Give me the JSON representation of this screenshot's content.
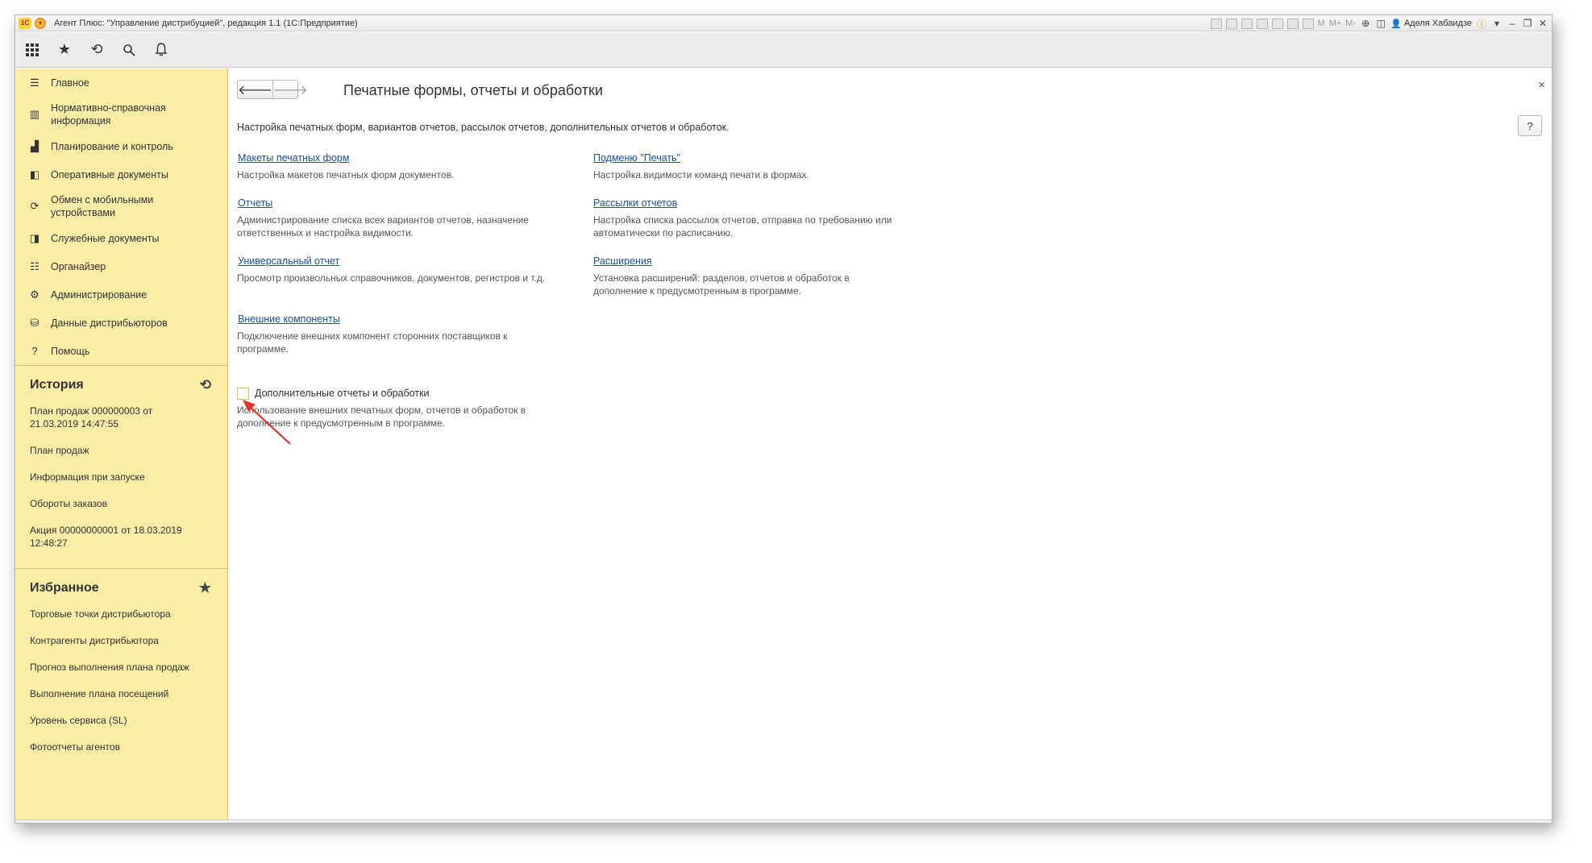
{
  "window": {
    "title": "Агент Плюс: \"Управление дистрибуцией\", редакция 1.1  (1С:Предприятие)",
    "user": "Аделя Хабаидзе",
    "toolbar_text": [
      "M",
      "M+",
      "M-"
    ]
  },
  "sections": [
    {
      "label": "Главное",
      "icon": "menu-icon"
    },
    {
      "label": "Нормативно-справочная информация",
      "icon": "catalog-icon"
    },
    {
      "label": "Планирование и контроль",
      "icon": "chart-icon"
    },
    {
      "label": "Оперативные документы",
      "icon": "documents-icon"
    },
    {
      "label": "Обмен с мобильными устройствами",
      "icon": "sync-icon"
    },
    {
      "label": "Служебные документы",
      "icon": "service-docs-icon"
    },
    {
      "label": "Органайзер",
      "icon": "organizer-icon"
    },
    {
      "label": "Администрирование",
      "icon": "gear-icon"
    },
    {
      "label": "Данные дистрибьюторов",
      "icon": "distributor-data-icon"
    },
    {
      "label": "Помощь",
      "icon": "question-icon"
    }
  ],
  "history": {
    "title": "История",
    "items": [
      "План продаж 000000003 от 21.03.2019 14:47:55",
      "План продаж",
      "Информация при запуске",
      "Обороты заказов",
      "Акция 00000000001 от 18.03.2019 12:48:27"
    ]
  },
  "favorites": {
    "title": "Избранное",
    "items": [
      "Торговые точки дистрибьютора",
      "Контрагенты дистрибьютора",
      "Прогноз выполнения плана продаж",
      "Выполнение плана посещений",
      "Уровень сервиса (SL)",
      "Фотоотчеты агентов"
    ]
  },
  "main": {
    "title": "Печатные формы, отчеты и обработки",
    "description": "Настройка печатных форм, вариантов отчетов, рассылок отчетов, дополнительных отчетов и обработок.",
    "help": "?",
    "close": "×",
    "links": {
      "layouts": {
        "label": "Макеты печатных форм",
        "desc": "Настройка макетов печатных форм документов."
      },
      "print_submenu": {
        "label": "Подменю \"Печать\"",
        "desc": "Настройка видимости команд печати в формах."
      },
      "reports": {
        "label": "Отчеты",
        "desc": "Администрирование списка всех вариантов отчетов, назначение ответственных и настройка видимости."
      },
      "mailing": {
        "label": "Рассылки отчетов",
        "desc": "Настройка списка рассылок отчетов, отправка по требованию или автоматически по расписанию."
      },
      "universal_report": {
        "label": "Универсальный отчет",
        "desc": "Просмотр произвольных справочников, документов, регистров и т.д."
      },
      "extensions": {
        "label": "Расширения",
        "desc": "Установка расширений: разделов, отчетов и обработок в дополнение к предусмотренным в программе."
      },
      "external_components": {
        "label": "Внешние компоненты",
        "desc": "Подключение внешних компонент сторонних поставщиков к программе."
      }
    },
    "additional": {
      "label": "Дополнительные отчеты и обработки",
      "desc": "Использование внешних печатных форм, отчетов и обработок в дополнение к предусмотренным в программе.",
      "checked": false
    }
  },
  "colors": {
    "sidebar": "#fbeda6",
    "link": "#1a4fa8",
    "annotation_arrow": "#e0342a"
  }
}
